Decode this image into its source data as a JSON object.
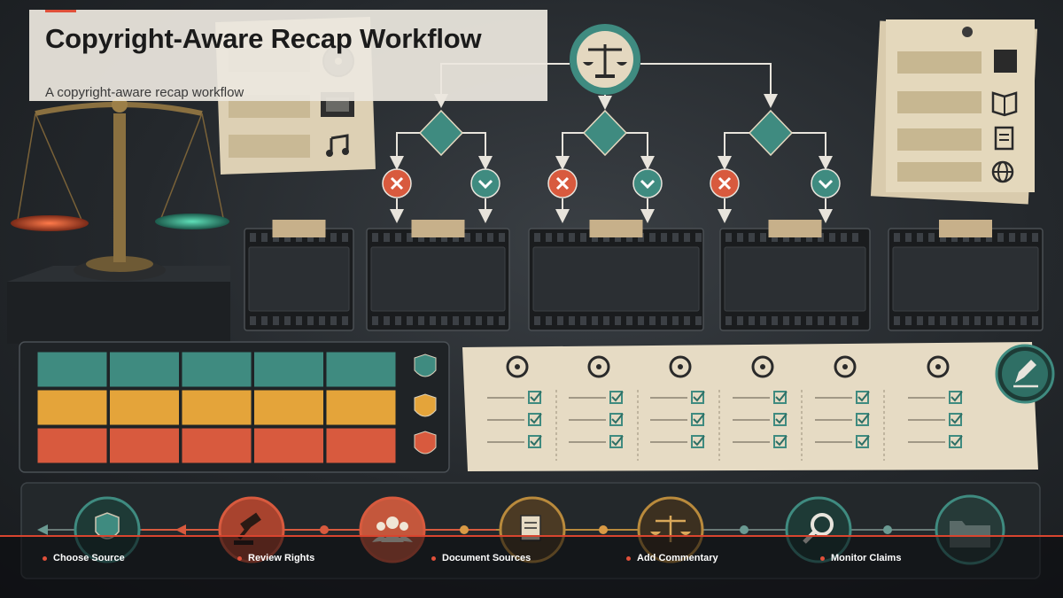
{
  "header": {
    "title": "Copyright-Aware Recap Workflow",
    "subtitle": "A copyright-aware recap workflow"
  },
  "colors": {
    "accent_red": "#e0503a",
    "teal": "#3f8b80",
    "amber": "#e4a43a",
    "coral": "#d85a3e",
    "parchment": "#e4d8c0",
    "dark_bg": "#24282c"
  },
  "flow": {
    "root_icon": "scales-icon",
    "branches": 3,
    "decision_icons": [
      "reject-x-icon",
      "approve-check-icon"
    ]
  },
  "film_frames": 5,
  "left_note_icons": [
    "film-reel-icon",
    "film-strip-icon",
    "music-note-icon"
  ],
  "right_note_icons": [
    "clapperboard-icon",
    "book-icon",
    "document-icon",
    "globe-icon"
  ],
  "risk_grid": {
    "rows": [
      "green",
      "amber",
      "red"
    ],
    "columns": 5,
    "shield_icons": [
      "shield-green-icon",
      "shield-amber-icon",
      "shield-red-icon"
    ]
  },
  "checklist": {
    "columns": [
      {
        "icon": "head-profile-icon",
        "checks": 3
      },
      {
        "icon": "palette-icon",
        "checks": 3
      },
      {
        "icon": "speaker-icon",
        "checks": 3
      },
      {
        "icon": "crop-icon",
        "checks": 3
      },
      {
        "icon": "gauge-icon",
        "checks": 3
      },
      {
        "icon": "scissors-icon",
        "checks": 3
      }
    ],
    "action_icon": "edit-pencil-icon"
  },
  "timeline_icons": [
    "shield-icon",
    "gavel-icon",
    "people-icon",
    "documents-icon",
    "scales-icon",
    "magnifier-icon",
    "folder-icon"
  ],
  "footer": {
    "steps": [
      "Choose Source",
      "Review Rights",
      "Document Sources",
      "Add Commentary",
      "Monitor Claims"
    ]
  }
}
